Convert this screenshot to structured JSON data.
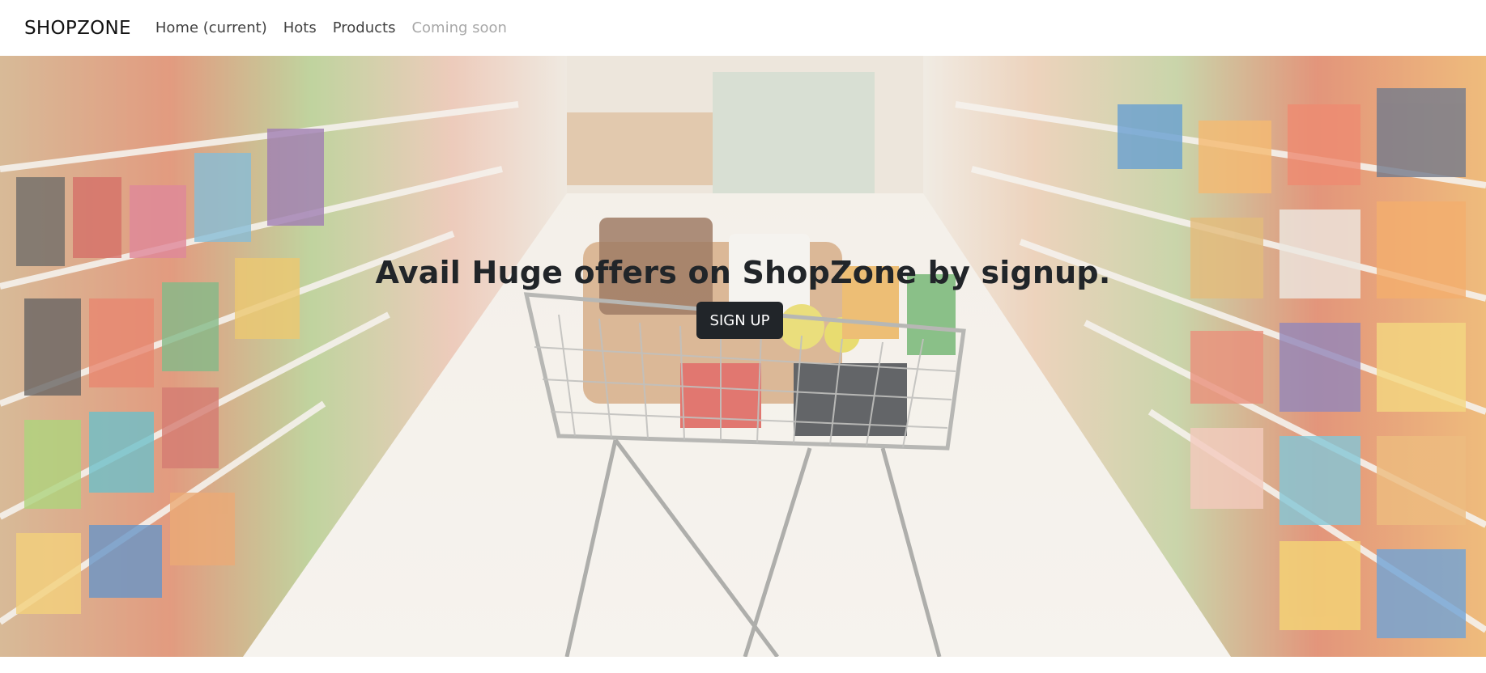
{
  "navbar": {
    "brand": "SHOPZONE",
    "links": [
      {
        "label": "Home (current)"
      },
      {
        "label": "Hots"
      },
      {
        "label": "Products"
      },
      {
        "label": "Coming soon",
        "disabled": true
      }
    ]
  },
  "hero": {
    "title": "Avail Huge offers on ShopZone by signup.",
    "signup_label": "SIGN UP",
    "background_image": "supermarket-aisle-with-shopping-cart-image"
  },
  "colors": {
    "button_bg": "#212529",
    "button_text": "#ffffff",
    "title_text": "#212529",
    "nav_disabled": "#a6a6a6"
  }
}
